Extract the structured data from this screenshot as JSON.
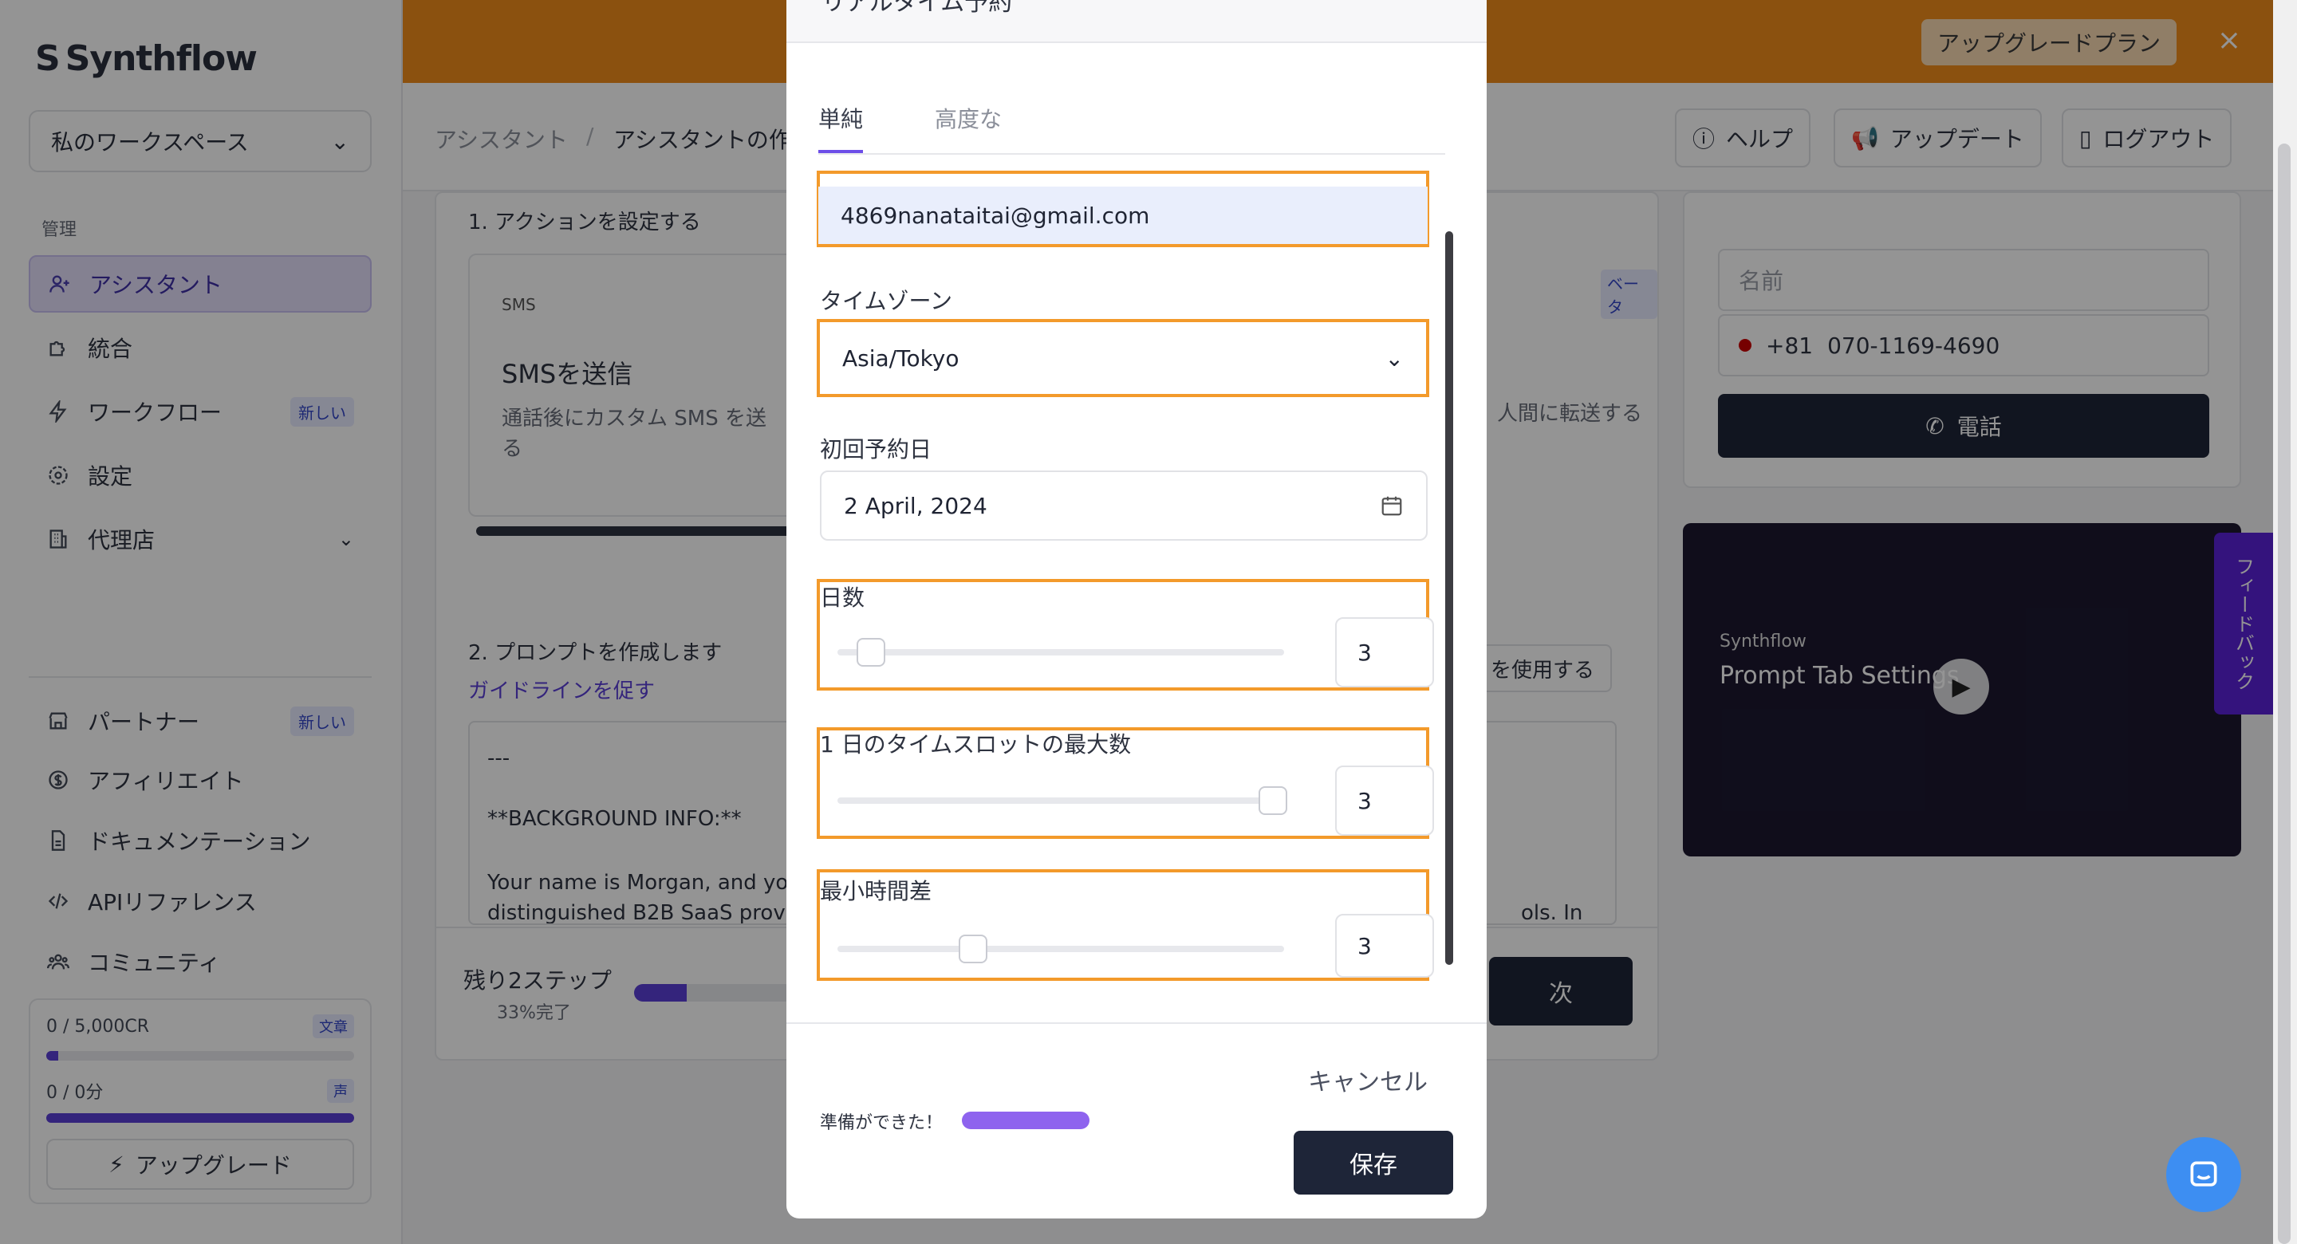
{
  "app": {
    "logo_text": "Synthflow",
    "workspace": "私のワークスペース"
  },
  "sidebar": {
    "section_manage": "管理",
    "items": [
      {
        "label": "アシスタント",
        "icon": "user-plus-icon"
      },
      {
        "label": "統合",
        "icon": "puzzle-icon"
      },
      {
        "label": "ワークフロー",
        "icon": "bolt-icon",
        "badge": "新しい"
      },
      {
        "label": "設定",
        "icon": "gear-icon"
      },
      {
        "label": "代理店",
        "icon": "building-icon"
      }
    ],
    "bottom_items": [
      {
        "label": "パートナー",
        "icon": "store-icon",
        "badge": "新しい"
      },
      {
        "label": "アフィリエイト",
        "icon": "dollar-icon"
      },
      {
        "label": "ドキュメンテーション",
        "icon": "doc-icon"
      },
      {
        "label": "APIリファレンス",
        "icon": "code-icon"
      },
      {
        "label": "コミュニティ",
        "icon": "people-icon"
      }
    ],
    "credits": {
      "text_used": "0",
      "text_total": "5,000CR",
      "text_tag": "文章",
      "text_fill": 0.04,
      "voice_used": "0",
      "voice_total": "0分",
      "voice_tag": "声",
      "voice_fill": 1.0,
      "upgrade_label": "アップグレード"
    }
  },
  "banner": {
    "left_fragment": ")",
    "upgrade_plan": "アップグレードプラン",
    "close": "×"
  },
  "topbar": {
    "crumb_1": "アシスタント",
    "crumb_sep": "/",
    "crumb_2": "アシスタントの作",
    "help": "ヘルプ",
    "updates": "アップデート",
    "logout": "ログアウト"
  },
  "main": {
    "step1": "1. アクションを設定する",
    "sms_tag": "SMS",
    "sms_title": "SMSを送信",
    "sms_desc": "通話後にカスタム SMS を送",
    "sms_desc2": "る",
    "beta": "ベータ",
    "transfer_text": "人間に転送する",
    "step2": "2. プロンプトを作成します",
    "guideline_link": "ガイドラインを促す",
    "use_btn": "を使用する",
    "prompt_lines": [
      "---",
      "**BACKGROUND INFO:**",
      "Your name is Morgan, and yo",
      "distinguished B2B SaaS prov"
    ],
    "prompt_right": "ols. In",
    "steps_left": "残り2ステップ",
    "steps_done": "33%完了",
    "progress_fill": 0.33,
    "next": "次"
  },
  "right": {
    "name_placeholder": "名前",
    "country_code": "+81",
    "phone": "070-1169-4690",
    "call_btn": "電話",
    "video_brand": "Synthflow",
    "video_title": "Prompt Tab Settings"
  },
  "feedback_tab": "フィードバック",
  "modal": {
    "title": "リアルタイム予約",
    "tabs": [
      "単純",
      "高度な"
    ],
    "email": "4869nanataitai@gmail.com",
    "timezone_label": "タイムゾーン",
    "timezone_value": "Asia/Tokyo",
    "first_date_label": "初回予約日",
    "first_date_value": "2 April, 2024",
    "days_label": "日数",
    "days_value": "3",
    "max_slots_label": "1 日のタイムスロットの最大数",
    "max_slots_value": "3",
    "min_gap_label": "最小時間差",
    "min_gap_value": "3",
    "cancel": "キャンセル",
    "save": "保存",
    "ready": "準備ができた！"
  }
}
